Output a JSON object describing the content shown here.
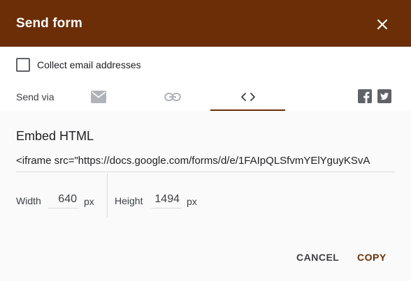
{
  "dialog": {
    "title": "Send form"
  },
  "collect_email": {
    "label": "Collect email addresses",
    "checked": false
  },
  "send_via": {
    "label": "Send via",
    "tabs": [
      {
        "icon": "email-icon",
        "selected": false
      },
      {
        "icon": "link-icon",
        "selected": false
      },
      {
        "icon": "embed-icon",
        "selected": true
      }
    ],
    "social": [
      {
        "icon": "facebook-icon"
      },
      {
        "icon": "twitter-icon"
      }
    ]
  },
  "embed": {
    "title": "Embed HTML",
    "code": "<iframe src=\"https://docs.google.com/forms/d/e/1FAIpQLSfvmYElYguyKSvA",
    "width_label": "Width",
    "width_value": "640",
    "width_unit": "px",
    "height_label": "Height",
    "height_value": "1494",
    "height_unit": "px"
  },
  "actions": {
    "cancel": "CANCEL",
    "copy": "COPY"
  },
  "colors": {
    "accent": "#6b2e06",
    "panel_bg": "#fafafa",
    "icon_gray": "#9aa0a6"
  }
}
